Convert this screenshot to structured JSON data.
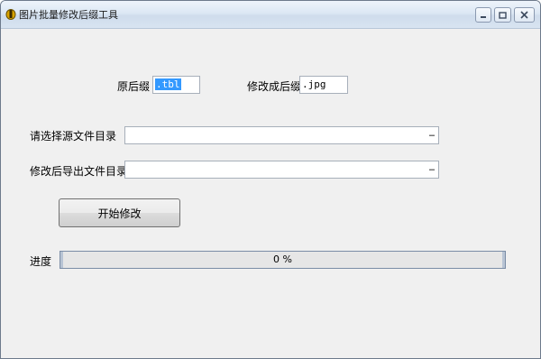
{
  "window": {
    "title": "图片批量修改后缀工具",
    "icon": "app-icon",
    "controls": {
      "minimize": "minimize-icon",
      "maximize": "maximize-icon",
      "close": "close-icon"
    }
  },
  "form": {
    "orig_suffix_label": "原后缀",
    "orig_suffix_value": ".tbl",
    "new_suffix_label": "修改成后缀",
    "new_suffix_value": ".jpg",
    "source_dir_label": "请选择源文件目录",
    "source_dir_value": "",
    "source_browse": "…",
    "export_dir_label": "修改后导出文件目录",
    "export_dir_value": "",
    "export_browse": "…",
    "start_button": "开始修改",
    "progress_label": "进度",
    "progress_text": "0 %",
    "progress_value": 0
  }
}
